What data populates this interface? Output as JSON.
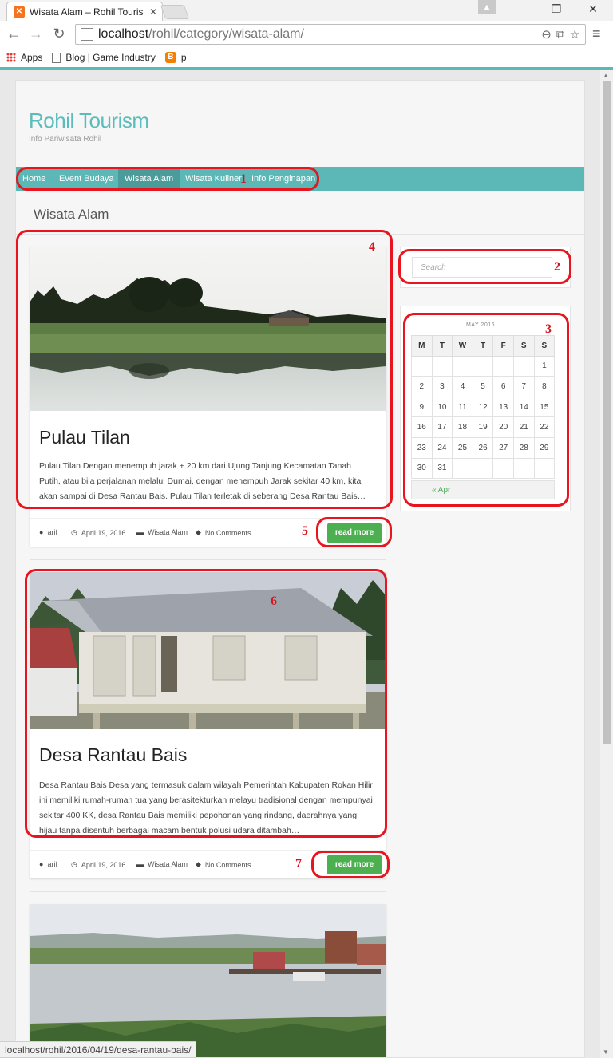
{
  "browser": {
    "tab_title": "Wisata Alam – Rohil Touris",
    "url_host": "localhost",
    "url_path": "/rohil/category/wisata-alam/",
    "bookmarks": [
      "Apps",
      "Blog | Game Industry",
      "p"
    ],
    "status_url": "localhost/rohil/2016/04/19/desa-rantau-bais/"
  },
  "site": {
    "title": "Rohil Tourism",
    "description": "Info Pariwisata Rohil"
  },
  "nav": {
    "items": [
      "Home",
      "Event Budaya",
      "Wisata Alam",
      "Wisata Kuliner",
      "Info Penginapan"
    ],
    "active": "Wisata Alam"
  },
  "page": {
    "heading": "Wisata Alam"
  },
  "posts": [
    {
      "title": "Pulau Tilan",
      "excerpt_lines": [
        "Pulau Tilan Dengan menempuh jarak + 20 km dari Ujung Tanjung Kecamatan Tanah",
        "Putih, atau bila perjalanan melalui Dumai, dengan menempuh Jarak sekitar 40 km, kita",
        "akan sampai di Desa Rantau Bais. Pulau Tilan terletak di seberang Desa Rantau Bais…"
      ],
      "author": "arif",
      "date": "April 19, 2016",
      "category": "Wisata Alam",
      "comments": "No Comments",
      "read_more": "read more"
    },
    {
      "title": "Desa Rantau Bais",
      "excerpt_lines": [
        "Desa Rantau Bais Desa yang termasuk dalam wilayah Pemerintah Kabupaten Rokan Hilir",
        "ini memiliki rumah-rumah tua yang berasitekturkan melayu tradisional dengan mempunyai",
        "sekitar 400 KK, desa Rantau Bais memiliki pepohonan yang rindang, daerahnya yang",
        "hijau tanpa disentuh berbagai macam bentuk polusi udara ditambah…"
      ],
      "author": "arif",
      "date": "April 19, 2016",
      "category": "Wisata Alam",
      "comments": "No Comments",
      "read_more": "read more"
    }
  ],
  "sidebar": {
    "search_placeholder": "Search",
    "calendar": {
      "caption": "MAY 2016",
      "weekdays": [
        "M",
        "T",
        "W",
        "T",
        "F",
        "S",
        "S"
      ],
      "weeks": [
        [
          "",
          "",
          "",
          "",
          "",
          "",
          "1"
        ],
        [
          "2",
          "3",
          "4",
          "5",
          "6",
          "7",
          "8"
        ],
        [
          "9",
          "10",
          "11",
          "12",
          "13",
          "14",
          "15"
        ],
        [
          "16",
          "17",
          "18",
          "19",
          "20",
          "21",
          "22"
        ],
        [
          "23",
          "24",
          "25",
          "26",
          "27",
          "28",
          "29"
        ],
        [
          "30",
          "31",
          "",
          "",
          "",
          "",
          ""
        ]
      ],
      "prev_link": "« Apr"
    }
  },
  "annotations": [
    "1",
    "2",
    "3",
    "4",
    "5",
    "6",
    "7"
  ],
  "colors": {
    "accent": "#5bb8b6",
    "nav_active": "#4a9b9a",
    "button": "#4caf50",
    "annotation": "#e8141e"
  }
}
